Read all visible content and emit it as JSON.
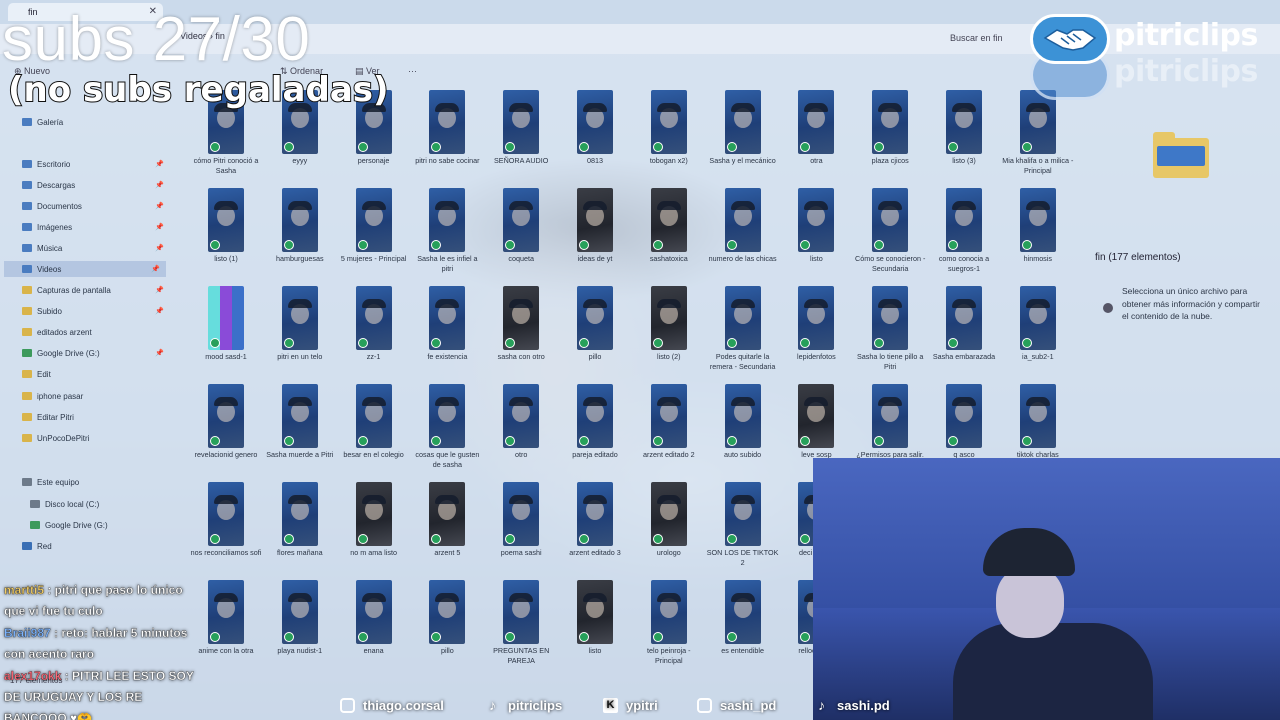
{
  "window": {
    "tab_title": "fin",
    "address_path": "Videos  ›  fin",
    "search_placeholder": "Buscar en fin",
    "toolbar": {
      "new_label": "Nuevo",
      "sort_label": "Ordenar",
      "view_label": "Ver",
      "more_label": "···"
    }
  },
  "sidebar": {
    "items": [
      {
        "label": "Galería",
        "icon": "gallery-icon"
      },
      {
        "label": "Escritorio",
        "icon": "desktop-icon",
        "pinned": true
      },
      {
        "label": "Descargas",
        "icon": "downloads-icon",
        "pinned": true
      },
      {
        "label": "Documentos",
        "icon": "documents-icon",
        "pinned": true
      },
      {
        "label": "Imágenes",
        "icon": "pictures-icon",
        "pinned": true
      },
      {
        "label": "Música",
        "icon": "music-icon",
        "pinned": true
      },
      {
        "label": "Videos",
        "icon": "videos-icon",
        "pinned": true,
        "active": true
      },
      {
        "label": "Capturas de pantalla",
        "icon": "folder-icon",
        "pinned": true
      },
      {
        "label": "Subido",
        "icon": "folder-icon",
        "pinned": true
      },
      {
        "label": "editados arzent",
        "icon": "folder-icon"
      },
      {
        "label": "Google Drive (G:)",
        "icon": "google-drive-icon",
        "pinned": true
      },
      {
        "label": "Edit",
        "icon": "folder-icon"
      },
      {
        "label": "iphone pasar",
        "icon": "folder-icon"
      },
      {
        "label": "Editar Pitri",
        "icon": "folder-icon"
      },
      {
        "label": "UnPocoDePitri",
        "icon": "folder-icon"
      },
      {
        "label": "Este equipo",
        "icon": "this-pc-icon"
      },
      {
        "label": "Disco local (C:)",
        "icon": "drive-icon"
      },
      {
        "label": "Google Drive (G:)",
        "icon": "google-drive-icon"
      },
      {
        "label": "Red",
        "icon": "network-icon"
      }
    ]
  },
  "files": [
    [
      "cómo Pitri conoció a Sasha",
      "eyyy",
      "personaje",
      "pitri no sabe cocinar",
      "SEÑORA AUDIO",
      "0813",
      "tobogan x2)",
      "Sasha y el mecánico",
      "otra",
      "plaza cjicos",
      "listo (3)",
      "Mia khalifa o a milica - Principal"
    ],
    [
      "listo (1)",
      "hamburguesas",
      "5 mujeres - Principal",
      "Sasha le es infiel a pitri",
      "coqueta",
      "ideas de yt",
      "sashatoxica",
      "numero de las chicas",
      "listo",
      "Cómo se conocieron - Secundaria",
      "como conocia a suegros-1",
      "hinmosis"
    ],
    [
      "mood sasd-1",
      "pitri en un telo",
      "zz-1",
      "fe existencia",
      "sasha con otro",
      "pillo",
      "listo (2)",
      "Podes quitarle la remera - Secundaria",
      "lepidenfotos",
      "Sasha lo tiene pillo a Pitri",
      "Sasha embarazada",
      "ia_sub2-1"
    ],
    [
      "revelacionid genero",
      "Sasha muerde a Pitri",
      "besar en el colegio",
      "cosas que le gusten de sasha",
      "otro",
      "pareja editado",
      "arzent editado 2",
      "auto subido",
      "leve sosp",
      "¿Permisos para salir. La divertida",
      "q asco",
      "tiktok charlas"
    ],
    [
      "nos reconciliamos sofi",
      "flores mañana",
      "no m ama listo",
      "arzent 5",
      "poema sashi",
      "arzent editado 3",
      "urologo",
      "SON LOS DE TIKTOK 2",
      "deci q es n"
    ],
    [
      "anime con la otra",
      "playa nudist-1",
      "enana",
      "pillo",
      "PREGUNTAS EN PAREJA",
      "listo",
      "telo peinroja - Principal",
      "es entendible",
      "relloero a 2"
    ]
  ],
  "details": {
    "title": "fin (177 elementos)",
    "info_text": "Selecciona un único archivo para obtener más información y compartir el contenido de la nube."
  },
  "status_bar": "177 elementos",
  "overlay": {
    "subs_counter": "subs 27/30",
    "subs_note": "(no subs regaladas)",
    "brand_name": "pitriclips"
  },
  "chat": [
    {
      "user": "martti5",
      "text": "pitri que paso lo único que vi fue tu culo"
    },
    {
      "user": "Braii987",
      "text": "reto: hablar 5 minutos con acento raro"
    },
    {
      "user": "alex17okk",
      "text": "PITRI LEE ESTO SOY DE URUGUAY Y LOS RE BANCOOO ♥🫶"
    }
  ],
  "socials": [
    {
      "icon": "instagram-icon",
      "handle": "thiago.corsal"
    },
    {
      "icon": "tiktok-icon",
      "handle": "pitriclips"
    },
    {
      "icon": "kick-icon",
      "handle": "ypitri"
    },
    {
      "icon": "instagram-icon",
      "handle": "sashi_pd"
    },
    {
      "icon": "tiktok-icon",
      "handle": "sashi.pd"
    }
  ]
}
